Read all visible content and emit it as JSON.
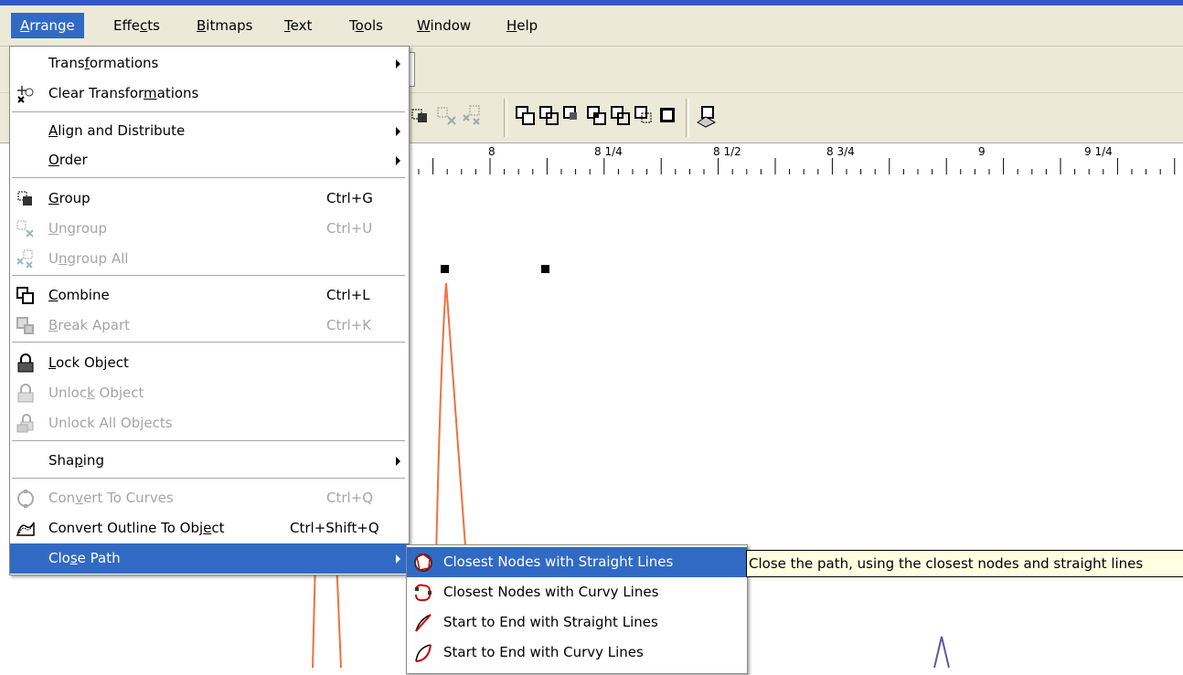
{
  "menubar": {
    "items": [
      {
        "pre": "",
        "acc": "A",
        "post": "rrange"
      },
      {
        "pre": "Effe",
        "acc": "c",
        "post": "ts"
      },
      {
        "pre": "",
        "acc": "B",
        "post": "itmaps"
      },
      {
        "pre": "",
        "acc": "T",
        "post": "ext"
      },
      {
        "pre": "T",
        "acc": "o",
        "post": "ols"
      },
      {
        "pre": "",
        "acc": "W",
        "post": "indow"
      },
      {
        "pre": "",
        "acc": "H",
        "post": "elp"
      }
    ]
  },
  "ruler": {
    "labels": [
      "8",
      "8 1/4",
      "8 1/2",
      "8 3/4",
      "9",
      "9 1/4"
    ]
  },
  "arrange_menu": {
    "items": [
      {
        "pre": "Trans",
        "acc": "f",
        "post": "ormations",
        "shortcut": ""
      },
      {
        "pre": "Clear Transfor",
        "acc": "m",
        "post": "ations",
        "shortcut": ""
      },
      {
        "pre": "",
        "acc": "A",
        "post": "lign and Distribute",
        "shortcut": ""
      },
      {
        "pre": "",
        "acc": "O",
        "post": "rder",
        "shortcut": ""
      },
      {
        "pre": "",
        "acc": "G",
        "post": "roup",
        "shortcut": "Ctrl+G"
      },
      {
        "pre": "",
        "acc": "U",
        "post": "ngroup",
        "shortcut": "Ctrl+U"
      },
      {
        "pre": "U",
        "acc": "n",
        "post": "group All",
        "shortcut": ""
      },
      {
        "pre": "",
        "acc": "C",
        "post": "ombine",
        "shortcut": "Ctrl+L"
      },
      {
        "pre": "",
        "acc": "B",
        "post": "reak  Apart",
        "shortcut": "Ctrl+K"
      },
      {
        "pre": "",
        "acc": "L",
        "post": "ock Object",
        "shortcut": ""
      },
      {
        "pre": "Unloc",
        "acc": "k",
        "post": " Object",
        "shortcut": ""
      },
      {
        "pre": "Unlock All Ob",
        "acc": "j",
        "post": "ects",
        "shortcut": ""
      },
      {
        "pre": "Sha",
        "acc": "p",
        "post": "ing",
        "shortcut": ""
      },
      {
        "pre": "Con",
        "acc": "v",
        "post": "ert To Curves",
        "shortcut": "Ctrl+Q"
      },
      {
        "pre": "Convert Outline To Obj",
        "acc": "e",
        "post": "ct",
        "shortcut": "Ctrl+Shift+Q"
      },
      {
        "pre": "Clo",
        "acc": "s",
        "post": "e Path",
        "shortcut": ""
      }
    ]
  },
  "close_path_submenu": {
    "items": [
      {
        "label": "Closest Nodes with Straight Lines",
        "icon": "closest-straight-icon"
      },
      {
        "label": "Closest Nodes with Curvy Lines",
        "icon": "closest-curvy-icon"
      },
      {
        "label": "Start to End with Straight Lines",
        "icon": "start-end-straight-icon"
      },
      {
        "label": "Start to End with Curvy Lines",
        "icon": "start-end-curvy-icon"
      }
    ]
  },
  "tooltip": {
    "text": "Close the path, using the closest nodes and straight lines"
  },
  "colors": {
    "highlight": "#316ac5",
    "curve_orange": "#f07040",
    "curve_blue": "#5a5aaa",
    "tooltip_bg": "#ffffe1"
  }
}
